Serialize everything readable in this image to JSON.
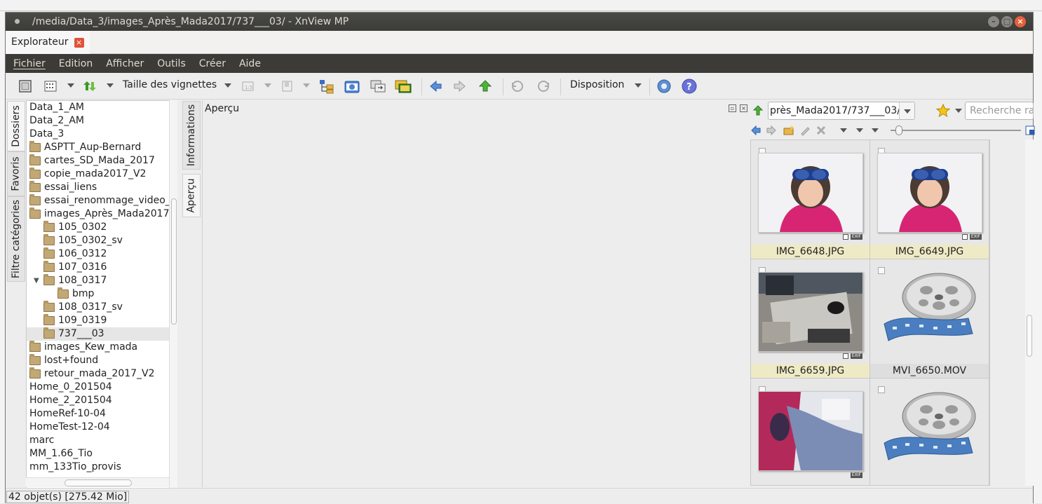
{
  "window": {
    "title": "/media/Data_3/images_Après_Mada2017/737___03/ - XnView MP"
  },
  "tab": {
    "label": "Explorateur"
  },
  "menu": [
    "Fichier",
    "Edition",
    "Afficher",
    "Outils",
    "Créer",
    "Aide"
  ],
  "toolbar": {
    "thumb_size_label": "Taille des vignettes",
    "layout_label": "Disposition"
  },
  "side_tabs": {
    "folders": "Dossiers",
    "favorites": "Favoris",
    "category_filter": "Filtre catégories"
  },
  "info_tabs": {
    "information": "Informations",
    "preview": "Aperçu"
  },
  "folder_tree": [
    {
      "label": "Data_1_AM",
      "level": 0,
      "folder_icon": false
    },
    {
      "label": "Data_2_AM",
      "level": 0,
      "folder_icon": false
    },
    {
      "label": "Data_3",
      "level": 0,
      "folder_icon": false
    },
    {
      "label": "ASPTT_Aup-Bernard",
      "level": 0,
      "folder_icon": true
    },
    {
      "label": "cartes_SD_Mada_2017",
      "level": 0,
      "folder_icon": true
    },
    {
      "label": "copie_mada2017_V2",
      "level": 0,
      "folder_icon": true
    },
    {
      "label": "essai_liens",
      "level": 0,
      "folder_icon": true
    },
    {
      "label": "essai_renommage_video_",
      "level": 0,
      "folder_icon": true
    },
    {
      "label": "images_Après_Mada2017",
      "level": 0,
      "folder_icon": true
    },
    {
      "label": "105_0302",
      "level": 1,
      "folder_icon": true
    },
    {
      "label": "105_0302_sv",
      "level": 1,
      "folder_icon": true
    },
    {
      "label": "106_0312",
      "level": 1,
      "folder_icon": true
    },
    {
      "label": "107_0316",
      "level": 1,
      "folder_icon": true
    },
    {
      "label": "108_0317",
      "level": 1,
      "folder_icon": true,
      "expanded": true
    },
    {
      "label": "bmp",
      "level": 2,
      "folder_icon": true
    },
    {
      "label": "108_0317_sv",
      "level": 1,
      "folder_icon": true
    },
    {
      "label": "109_0319",
      "level": 1,
      "folder_icon": true
    },
    {
      "label": "737___03",
      "level": 1,
      "folder_icon": true,
      "selected": true
    },
    {
      "label": "images_Kew_mada",
      "level": 0,
      "folder_icon": true
    },
    {
      "label": "lost+found",
      "level": 0,
      "folder_icon": true
    },
    {
      "label": "retour_mada_2017_V2",
      "level": 0,
      "folder_icon": true
    },
    {
      "label": "Home_0_201504",
      "level": 0,
      "folder_icon": false
    },
    {
      "label": "Home_2_201504",
      "level": 0,
      "folder_icon": false
    },
    {
      "label": "HomeRef-10-04",
      "level": 0,
      "folder_icon": false
    },
    {
      "label": "HomeTest-12-04",
      "level": 0,
      "folder_icon": false
    },
    {
      "label": "marc",
      "level": 0,
      "folder_icon": false
    },
    {
      "label": "MM_1.66_Tio",
      "level": 0,
      "folder_icon": false
    },
    {
      "label": "mm_133Tio_provis",
      "level": 0,
      "folder_icon": false
    }
  ],
  "preview": {
    "title": "Aperçu"
  },
  "browser": {
    "path": "près_Mada2017/737___03/",
    "search_placeholder": "Recherche ra",
    "exif_badge": "EXIF",
    "files": [
      {
        "name": "IMG_6648.JPG",
        "kind": "photo-child"
      },
      {
        "name": "IMG_6649.JPG",
        "kind": "photo-child"
      },
      {
        "name": "IMG_6659.JPG",
        "kind": "photo-desk"
      },
      {
        "name": "MVI_6650.MOV",
        "kind": "video"
      },
      {
        "name": "",
        "kind": "photo-pink"
      },
      {
        "name": "",
        "kind": "video"
      }
    ]
  },
  "status": {
    "text": "42 objet(s) [275.42 Mio]"
  }
}
